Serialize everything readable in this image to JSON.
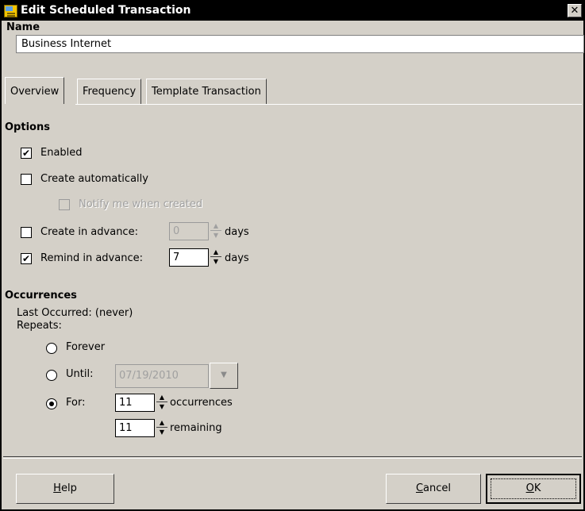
{
  "window": {
    "title": "Edit Scheduled Transaction",
    "close_glyph": "✕",
    "title_icon": "scheduled-transaction-icon"
  },
  "name": {
    "label": "Name",
    "value": "Business Internet"
  },
  "tabs": [
    {
      "label": "Overview",
      "active": true
    },
    {
      "label": "Frequency",
      "active": false
    },
    {
      "label": "Template Transaction",
      "active": false
    }
  ],
  "options": {
    "heading": "Options",
    "enabled": {
      "label": "Enabled",
      "checked": true
    },
    "create_automatically": {
      "label": "Create automatically",
      "checked": false
    },
    "notify_when_created": {
      "label": "Notify me when created",
      "checked": false,
      "disabled": true
    },
    "create_in_advance": {
      "label": "Create in advance:",
      "checked": false,
      "value": "0",
      "unit": "days",
      "disabled": true
    },
    "remind_in_advance": {
      "label": "Remind in advance:",
      "checked": true,
      "value": "7",
      "unit": "days"
    }
  },
  "occurrences": {
    "heading": "Occurrences",
    "last_occurred": "Last Occurred: (never)",
    "repeats_label": "Repeats:",
    "forever": {
      "label": "Forever",
      "selected": false
    },
    "until": {
      "label": "Until:",
      "selected": false,
      "date": "07/19/2010"
    },
    "for": {
      "label": "For:",
      "selected": true
    },
    "occurrences_value": "11",
    "occurrences_unit": "occurrences",
    "remaining_value": "11",
    "remaining_unit": "remaining"
  },
  "buttons": {
    "help": {
      "mnemonic": "H",
      "rest": "elp"
    },
    "cancel": {
      "mnemonic": "C",
      "rest": "ancel"
    },
    "ok": {
      "mnemonic": "O",
      "rest": "K"
    }
  },
  "glyphs": {
    "check": "✔",
    "spin_up": "▲",
    "spin_down": "▼",
    "dropdown": "▼"
  },
  "colors": {
    "dialog_bg": "#d4d0c8",
    "titlebar_bg": "#000000",
    "titlebar_text": "#ffffff",
    "disabled_text": "#a0a0a0"
  }
}
